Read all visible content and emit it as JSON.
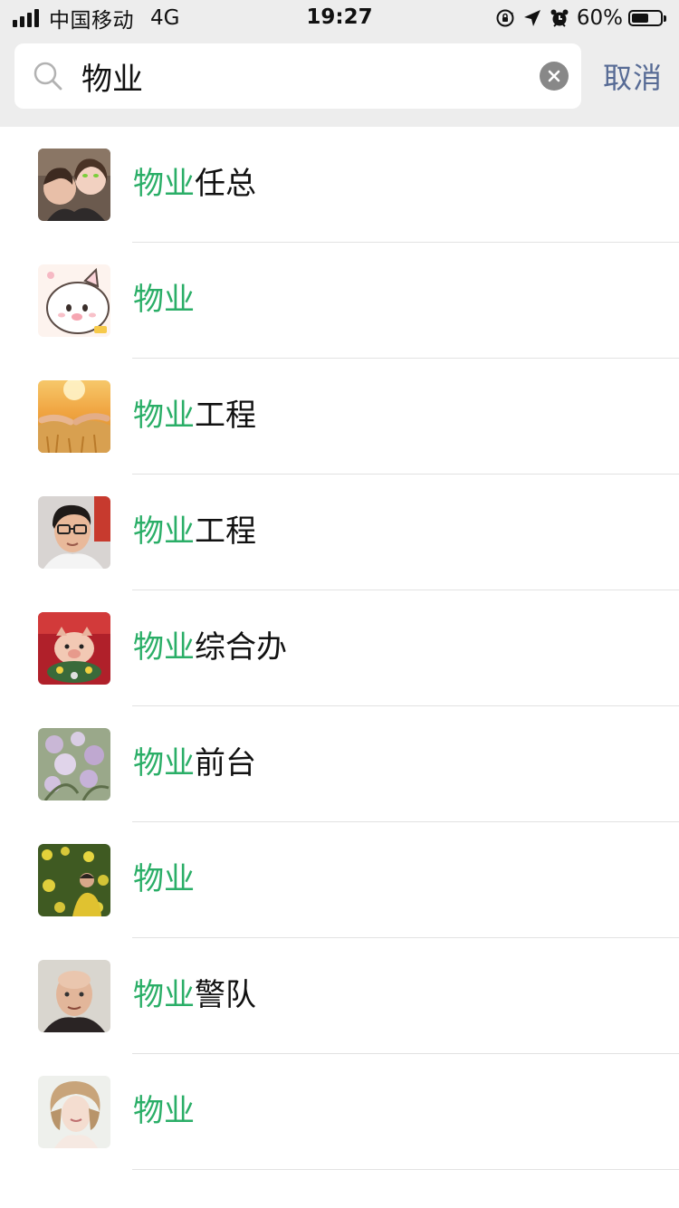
{
  "status_bar": {
    "carrier": "中国移动",
    "network": "4G",
    "time": "19:27",
    "battery_percent": "60%",
    "battery_level": 0.6,
    "icons": [
      "signal-icon",
      "orientation-lock-icon",
      "location-icon",
      "alarm-icon",
      "battery-icon"
    ]
  },
  "search": {
    "query": "物业",
    "cancel_label": "取消",
    "icon": "search-icon",
    "clear_icon": "clear-icon"
  },
  "results": [
    {
      "highlight": "物业",
      "rest": "任总",
      "avatar": "photo-two-women"
    },
    {
      "highlight": "物业",
      "rest": "",
      "avatar": "cartoon-pig"
    },
    {
      "highlight": "物业",
      "rest": "工程",
      "avatar": "holding-hands-sunset"
    },
    {
      "highlight": "物业",
      "rest": "工程",
      "avatar": "man-with-glasses"
    },
    {
      "highlight": "物业",
      "rest": "综合办",
      "avatar": "pig-toy-red"
    },
    {
      "highlight": "物业",
      "rest": "前台",
      "avatar": "purple-flowers"
    },
    {
      "highlight": "物业",
      "rest": "",
      "avatar": "person-in-yellow-flowers"
    },
    {
      "highlight": "物业",
      "rest": "警队",
      "avatar": "bald-man"
    },
    {
      "highlight": "物业",
      "rest": "",
      "avatar": "illustrated-woman"
    }
  ],
  "colors": {
    "highlight": "#2aae67",
    "cancel": "#576b95",
    "header_bg": "#ededed",
    "divider": "#e2e2e2"
  }
}
